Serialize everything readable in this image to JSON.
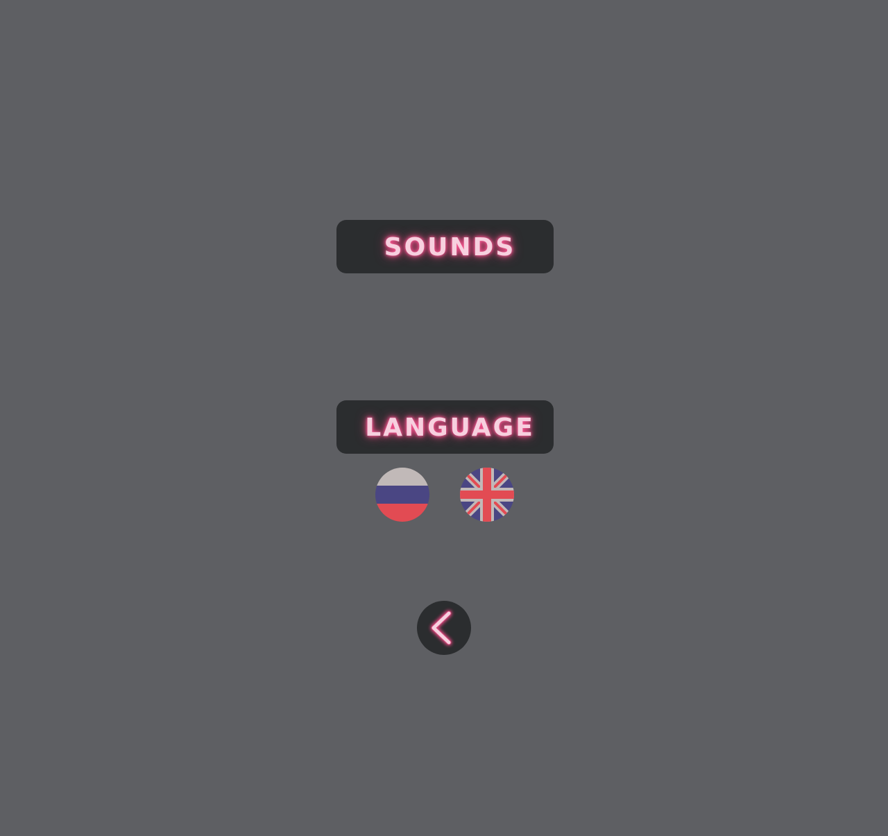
{
  "settings": {
    "sounds_label": "SOUNDS",
    "language_label": "LANGUAGE"
  },
  "languages": [
    {
      "code": "ru",
      "icon": "russia-flag-icon"
    },
    {
      "code": "en",
      "icon": "uk-flag-icon"
    }
  ],
  "navigation": {
    "back_icon": "chevron-left-icon"
  },
  "colors": {
    "background": "#5e5f63",
    "panel": "#2b2d2f",
    "neon_text": "#f7d0df",
    "neon_glow": "#ff4d8d",
    "flag_white": "#c1b9b8",
    "flag_blue": "#4a4683",
    "flag_red": "#e24b53"
  }
}
